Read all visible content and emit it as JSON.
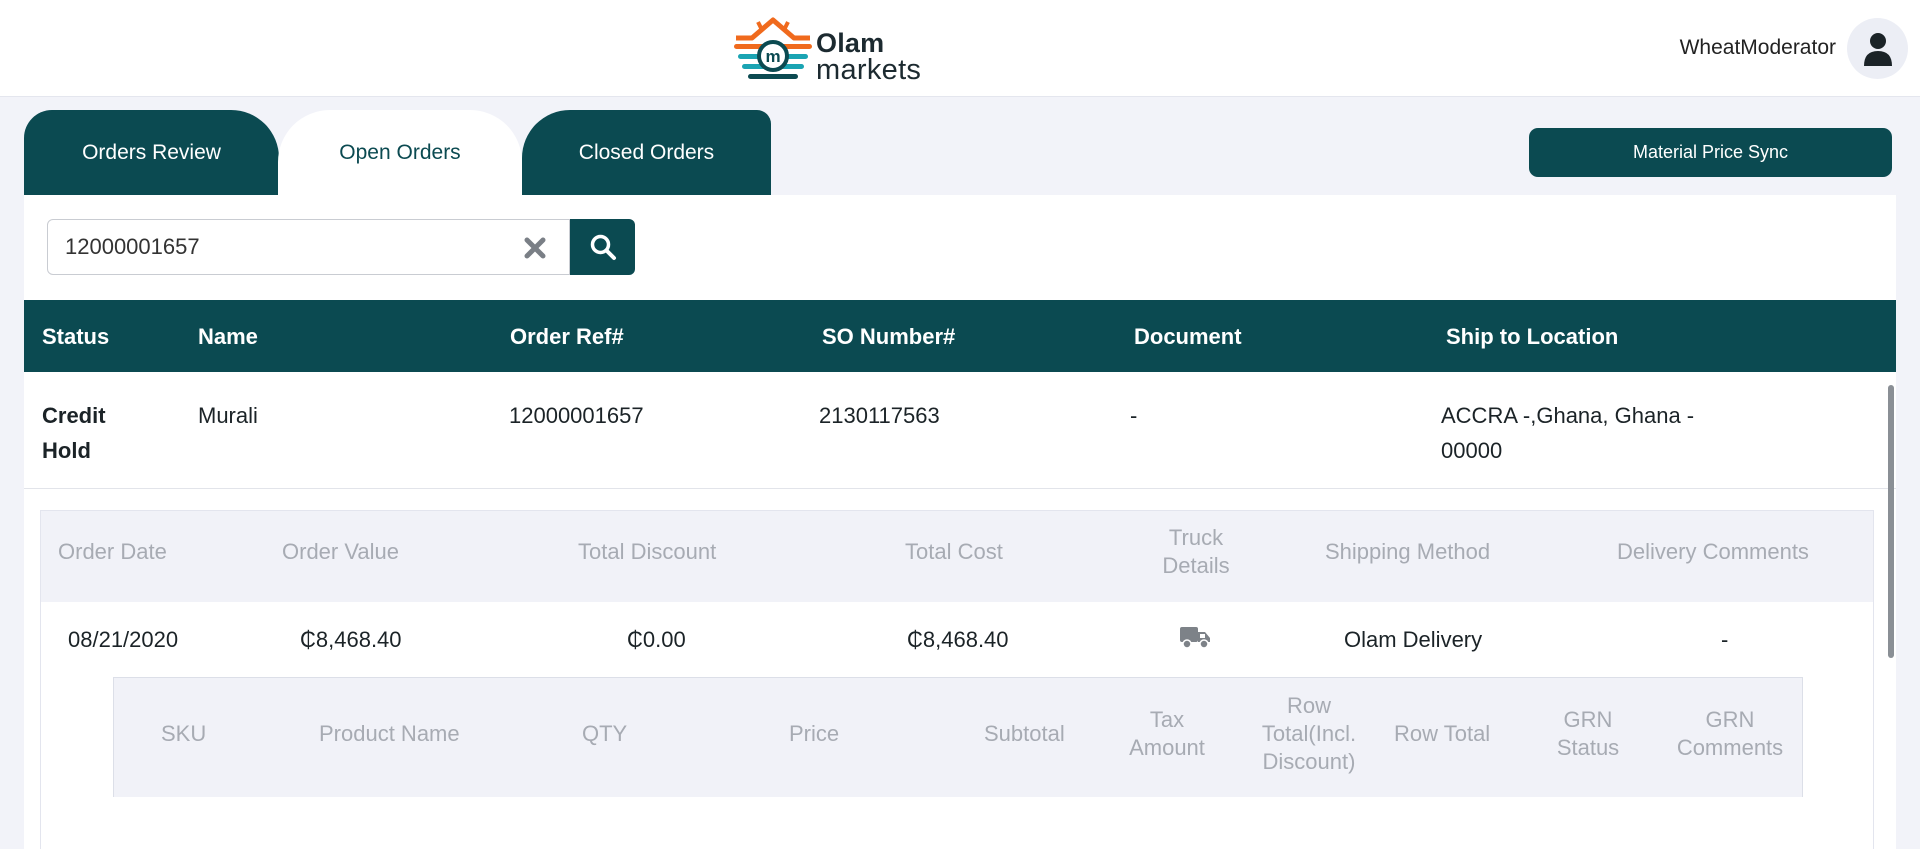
{
  "brand": {
    "name_top": "Olam",
    "name_bottom": "markets"
  },
  "user": {
    "name": "WheatModerator"
  },
  "tabs": [
    {
      "label": "Orders Review"
    },
    {
      "label": "Open Orders"
    },
    {
      "label": "Closed Orders"
    }
  ],
  "active_tab": "Open Orders",
  "sync_button": {
    "label": "Material Price Sync"
  },
  "search": {
    "value": "12000001657"
  },
  "orders_table": {
    "headers": [
      "Status",
      "Name",
      "Order Ref#",
      "SO Number#",
      "Document",
      "Ship to Location"
    ],
    "row": {
      "status_line1": "Credit",
      "status_line2": "Hold",
      "name": "Murali",
      "order_ref": "12000001657",
      "so_number": "2130117563",
      "document": "-",
      "location_line1": "ACCRA -,Ghana, Ghana -",
      "location_line2": "00000"
    }
  },
  "order_details": {
    "headers": {
      "order_date": "Order Date",
      "order_value": "Order Value",
      "total_discount": "Total Discount",
      "total_cost": "Total Cost",
      "truck_1": "Truck",
      "truck_2": "Details",
      "shipping_method": "Shipping Method",
      "delivery_comments": "Delivery Comments"
    },
    "values": {
      "order_date": "08/21/2020",
      "order_value": "₵8,468.40",
      "total_discount": "₵0.00",
      "total_cost": "₵8,468.40",
      "truck_icon": "truck-icon",
      "shipping_method": "Olam Delivery",
      "delivery_comments": "-"
    }
  },
  "line_items": {
    "headers": {
      "sku": "SKU",
      "product_name": "Product Name",
      "qty": "QTY",
      "price": "Price",
      "subtotal": "Subtotal",
      "tax_1": "Tax",
      "tax_2": "Amount",
      "rowtotal_incl_1": "Row",
      "rowtotal_incl_2": "Total(Incl.",
      "rowtotal_incl_3": "Discount)",
      "row_total": "Row Total",
      "grn_status_1": "GRN",
      "grn_status_2": "Status",
      "grn_comments_1": "GRN",
      "grn_comments_2": "Comments"
    }
  },
  "colors": {
    "primary": "#0b4a51",
    "background": "#f2f3f9",
    "muted_header_text": "#a7abb3",
    "logo_orange": "#f06a1d",
    "logo_teal": "#1aa4b3"
  }
}
